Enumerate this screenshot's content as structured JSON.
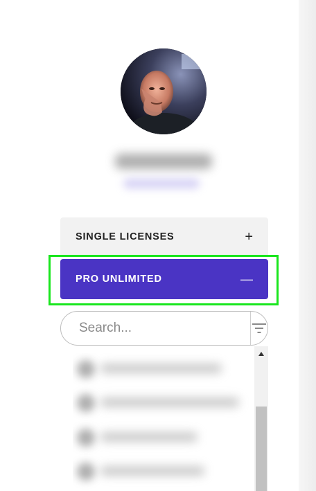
{
  "profile": {
    "avatar_alt": "Profile photo"
  },
  "accordion": {
    "single": {
      "label": "SINGLE LICENSES",
      "sign": "+"
    },
    "pro": {
      "label": "PRO UNLIMITED",
      "sign": "—"
    }
  },
  "search": {
    "value": "",
    "placeholder": "Search..."
  },
  "colors": {
    "accent": "#4a34c4",
    "highlight": "#19e61d",
    "panel": "#f2f2f2"
  },
  "icons": {
    "filter": "filter-icon",
    "expand": "plus-icon",
    "collapse": "minus-icon",
    "scroll_up": "arrow-up-icon"
  }
}
